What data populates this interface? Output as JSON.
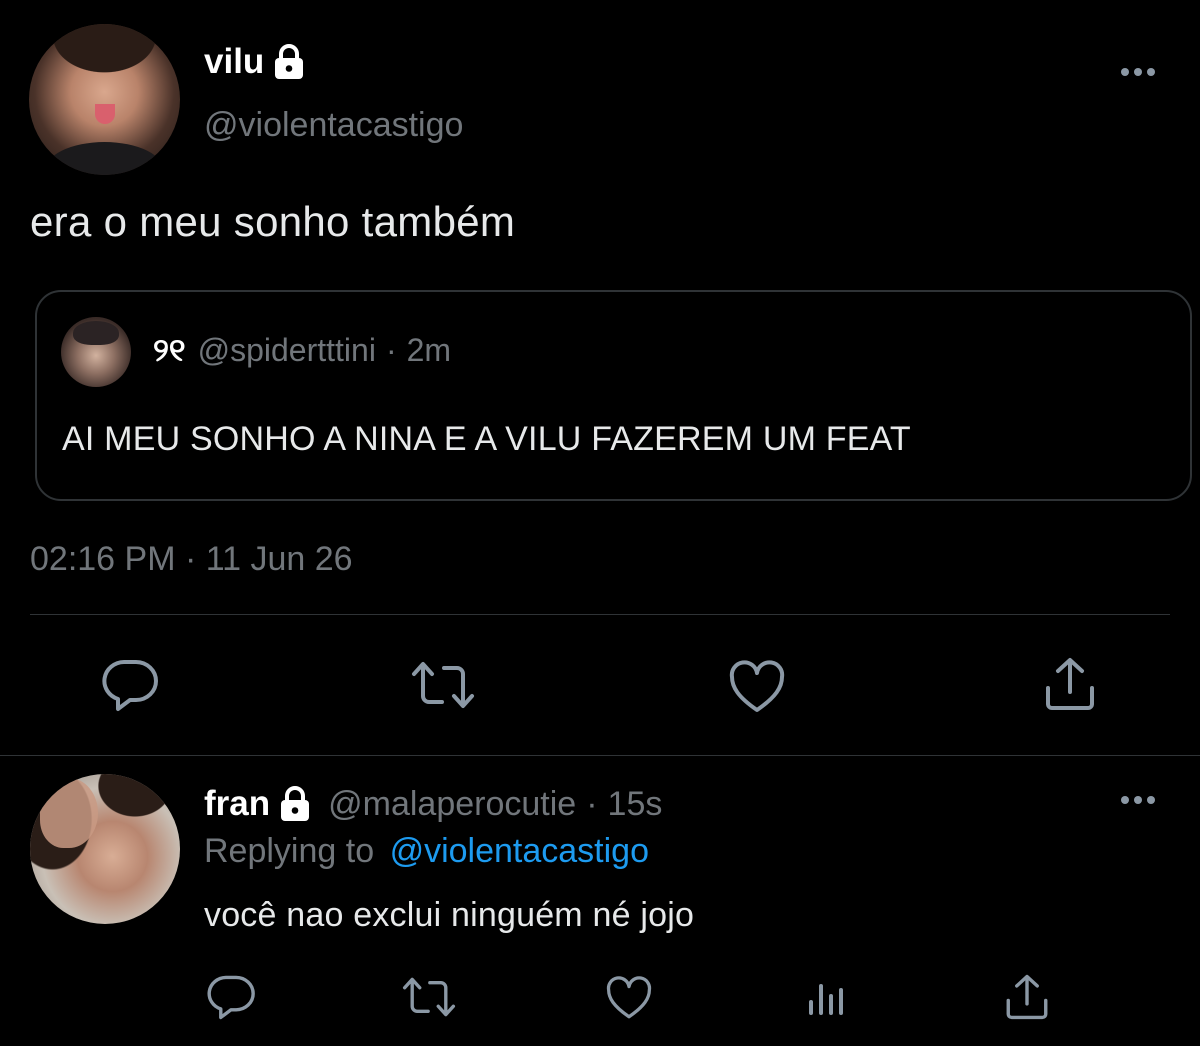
{
  "tweet": {
    "author_name": "vilu",
    "author_handle": "@violentacastigo",
    "text": "era o meu sonho também",
    "timestamp": "02:16 PM · 11 Jun 26",
    "quoted": {
      "author_name": "୨୧",
      "author_handle": "@spidertttini",
      "separator": "·",
      "time_ago": "2m",
      "text": "AI MEU SONHO A NINA E A VILU FAZEREM UM FEAT"
    }
  },
  "reply": {
    "author_name": "fran",
    "author_handle": "@malaperocutie",
    "separator": "·",
    "time_ago": "15s",
    "replying_to_label": "Replying to",
    "replying_to_handle": "@violentacastigo",
    "text": "você nao exclui ninguém né jojo"
  },
  "icons": {
    "lock": "lock-icon",
    "more": "more-horizontal-icon",
    "reply": "reply-icon",
    "retweet": "retweet-icon",
    "like": "heart-icon",
    "share": "share-icon",
    "analytics": "analytics-icon"
  },
  "colors": {
    "background": "#000000",
    "text": "#e7e9ea",
    "secondary_text": "#71767b",
    "link": "#1d9bf0",
    "border": "#2f3336",
    "icon": "#8b98a5"
  }
}
